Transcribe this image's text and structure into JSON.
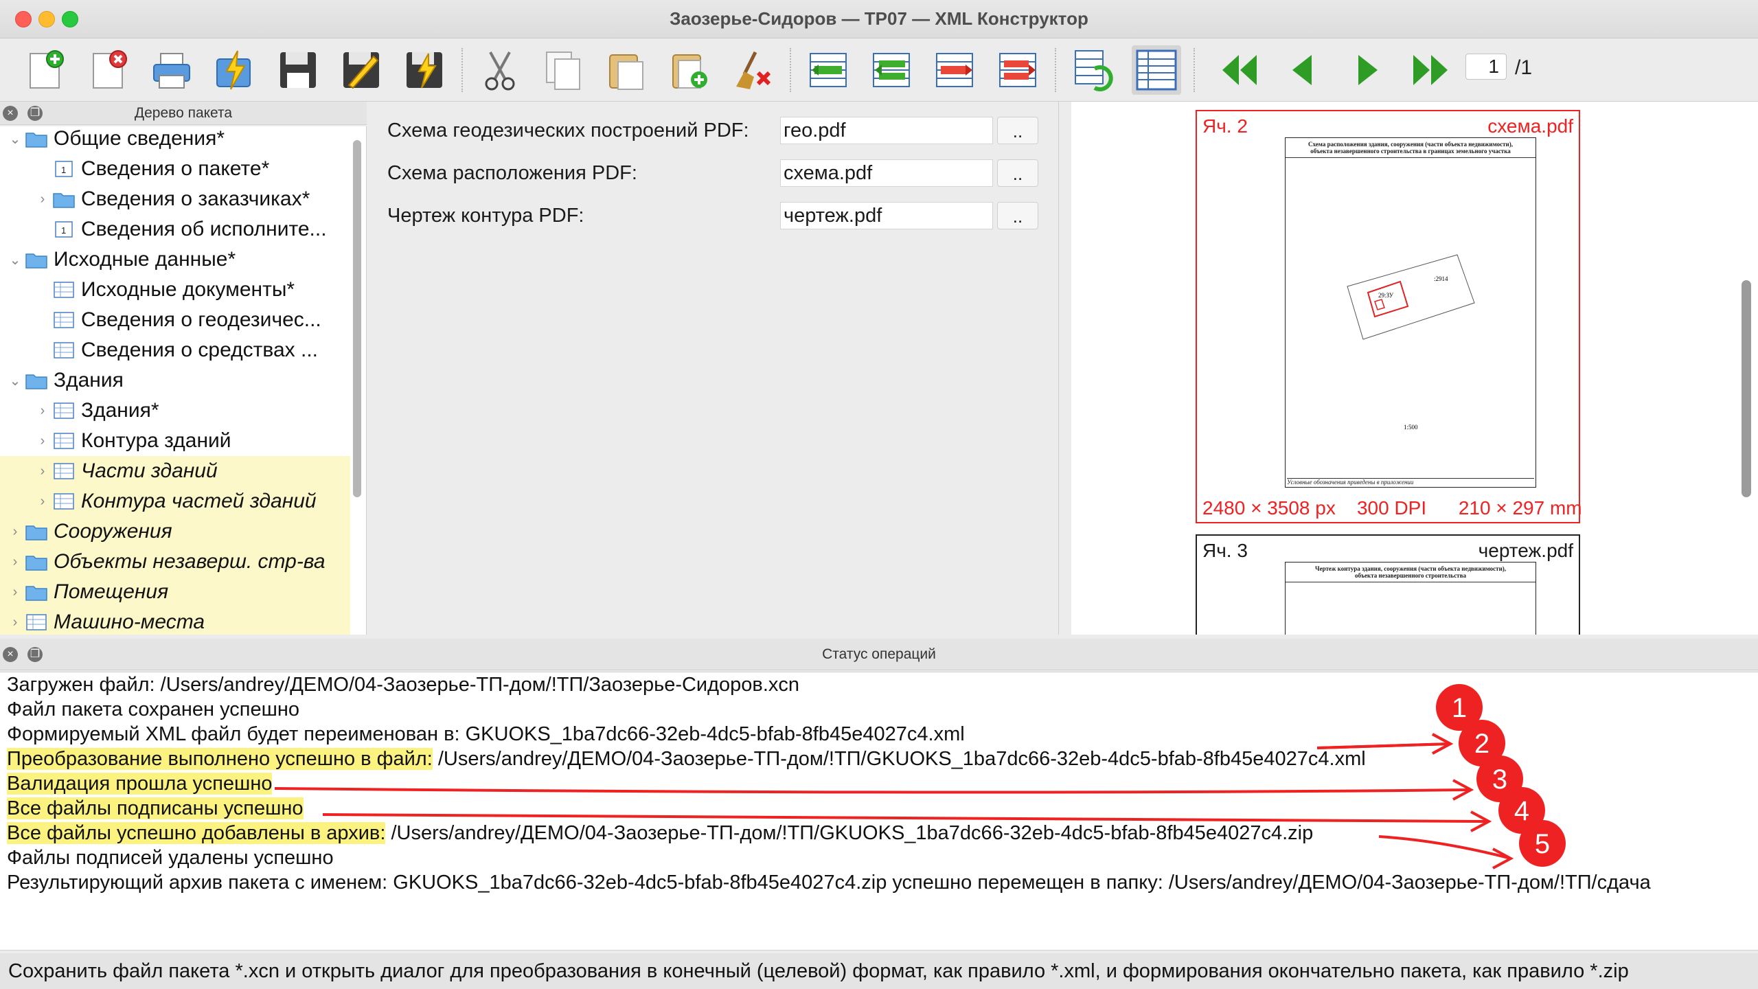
{
  "window": {
    "title": "Заозерье-Сидоров — ТР07 — XML Конструктор"
  },
  "toolbar": {
    "page_current": "1",
    "page_total": "/1",
    "buttons": [
      {
        "name": "new-package-icon"
      },
      {
        "name": "close-package-icon"
      },
      {
        "name": "print-icon"
      },
      {
        "name": "transform-icon"
      },
      {
        "name": "save-icon"
      },
      {
        "name": "sign-icon"
      },
      {
        "name": "sign-save-icon"
      },
      {
        "name": "cut-icon"
      },
      {
        "name": "copy-icon"
      },
      {
        "name": "paste-icon"
      },
      {
        "name": "paste-new-icon"
      },
      {
        "name": "clear-icon"
      },
      {
        "name": "insert-row-before-icon"
      },
      {
        "name": "insert-row-after-icon"
      },
      {
        "name": "move-row-icon"
      },
      {
        "name": "delete-row-icon"
      },
      {
        "name": "refresh-view-icon"
      },
      {
        "name": "table-view-icon"
      },
      {
        "name": "first-page-icon"
      },
      {
        "name": "prev-page-icon"
      },
      {
        "name": "next-page-icon"
      },
      {
        "name": "last-page-icon"
      }
    ]
  },
  "tree_panel": {
    "title": "Дерево пакета",
    "items": [
      {
        "label": "Общие сведения*",
        "level": 0,
        "expander": "⌄",
        "icon": "folder-icon",
        "italic": false,
        "highlight": false
      },
      {
        "label": "Сведения о пакете*",
        "level": 1,
        "expander": "",
        "icon": "form-icon",
        "italic": false,
        "highlight": false
      },
      {
        "label": "Сведения о заказчиках*",
        "level": 1,
        "expander": "›",
        "icon": "folder-icon",
        "italic": false,
        "highlight": false
      },
      {
        "label": "Сведения об исполните...",
        "level": 1,
        "expander": "",
        "icon": "form-icon",
        "italic": false,
        "highlight": false
      },
      {
        "label": "Исходные данные*",
        "level": 0,
        "expander": "⌄",
        "icon": "folder-icon",
        "italic": false,
        "highlight": false
      },
      {
        "label": "Исходные документы*",
        "level": 1,
        "expander": "",
        "icon": "table-icon",
        "italic": false,
        "highlight": false
      },
      {
        "label": "Сведения о геодезичес...",
        "level": 1,
        "expander": "",
        "icon": "table-icon",
        "italic": false,
        "highlight": false
      },
      {
        "label": "Сведения о средствах ...",
        "level": 1,
        "expander": "",
        "icon": "table-icon",
        "italic": false,
        "highlight": false
      },
      {
        "label": "Здания",
        "level": 0,
        "expander": "⌄",
        "icon": "folder-icon",
        "italic": false,
        "highlight": false
      },
      {
        "label": "Здания*",
        "level": 1,
        "expander": "›",
        "icon": "table-icon",
        "italic": false,
        "highlight": false
      },
      {
        "label": "Контура зданий",
        "level": 1,
        "expander": "›",
        "icon": "table-icon",
        "italic": false,
        "highlight": false
      },
      {
        "label": "Части зданий",
        "level": 1,
        "expander": "›",
        "icon": "table-icon",
        "italic": true,
        "highlight": true
      },
      {
        "label": "Контура частей зданий",
        "level": 1,
        "expander": "›",
        "icon": "table-icon",
        "italic": true,
        "highlight": true
      },
      {
        "label": "Сооружения",
        "level": 0,
        "expander": "›",
        "icon": "folder-icon",
        "italic": true,
        "highlight": true
      },
      {
        "label": "Объекты незаверш. стр-ва",
        "level": 0,
        "expander": "›",
        "icon": "folder-icon",
        "italic": true,
        "highlight": true
      },
      {
        "label": "Помещения",
        "level": 0,
        "expander": "›",
        "icon": "folder-icon",
        "italic": true,
        "highlight": true
      },
      {
        "label": "Машино-места",
        "level": 0,
        "expander": "›",
        "icon": "table-icon",
        "italic": true,
        "highlight": true
      }
    ]
  },
  "form": {
    "fields": [
      {
        "label": "Схема геодезических построений PDF:",
        "value": "гео.pdf",
        "button": ".."
      },
      {
        "label": "Схема расположения PDF:",
        "value": "схема.pdf",
        "button": ".."
      },
      {
        "label": "Чертеж контура PDF:",
        "value": "чертеж.pdf",
        "button": ".."
      }
    ]
  },
  "preview": {
    "cards": [
      {
        "cell": "Яч. 2",
        "file": "схема.pdf",
        "size_px": "2480 × 3508 px",
        "dpi": "300 DPI",
        "size_mm": "210 × 297 mm",
        "page_title": "Схема расположения здания, сооружения (части объекта недвижимости), объекта незавершенного строительства в границах земельного участка",
        "scale": "1:500",
        "footer": "Условные обозначения приведены в приложении",
        "label_a": ":2914",
        "label_b": "29:ЗУ"
      },
      {
        "cell": "Яч. 3",
        "file": "чертеж.pdf",
        "page_title": "Чертеж контура здания, сооружения (части объекта недвижимости), объекта незавершенного строительства"
      }
    ]
  },
  "status_panel": {
    "title": "Статус операций",
    "lines": [
      {
        "head": "Загружен файл: /Users/andrey/ДЕМО/04-Заозерье-ТП-дом/!ТП/Заозерье-Сидоров.xcn",
        "tail": ""
      },
      {
        "head": "Файл пакета сохранен успешно",
        "tail": ""
      },
      {
        "head": "Формируемый XML файл будет переименован в: GKUOKS_1ba7dc66-32eb-4dc5-bfab-8fb45e4027c4.xml",
        "tail": ""
      },
      {
        "head": "Преобразование выполнено успешно в файл:",
        "tail": " /Users/andrey/ДЕМО/04-Заозерье-ТП-дом/!ТП/GKUOKS_1ba7dc66-32eb-4dc5-bfab-8fb45e4027c4.xml"
      },
      {
        "head": "Валидация прошла успешно",
        "tail": ""
      },
      {
        "head": "Все файлы подписаны успешно",
        "tail": ""
      },
      {
        "head": "Все файлы успешно добавлены в архив:",
        "tail": " /Users/andrey/ДЕМО/04-Заозерье-ТП-дом/!ТП/GKUOKS_1ba7dc66-32eb-4dc5-bfab-8fb45e4027c4.zip"
      },
      {
        "head": "Файлы подписей удалены успешно",
        "tail": ""
      },
      {
        "head": "Результирующий архив пакета с именем: GKUOKS_1ba7dc66-32eb-4dc5-bfab-8fb45e4027c4.zip успешно перемещен в папку: /Users/andrey/ДЕМО/04-Заозерье-ТП-дом/!ТП/сдача",
        "tail": ""
      }
    ]
  },
  "annotations": {
    "markers": [
      "1",
      "2",
      "3",
      "4",
      "5"
    ],
    "color": "#ee2222"
  },
  "bottom_hint": "Сохранить файл пакета *.xcn и открыть диалог для преобразования в конечный (целевой) формат, как правило *.xml, и формирования окончательно пакета, как правило *.zip",
  "colors": {
    "highlight": "#fbf27f",
    "tree_highlight": "#fcf8c9",
    "accent_red": "#ee2222",
    "nav_green": "#2e9c25"
  }
}
